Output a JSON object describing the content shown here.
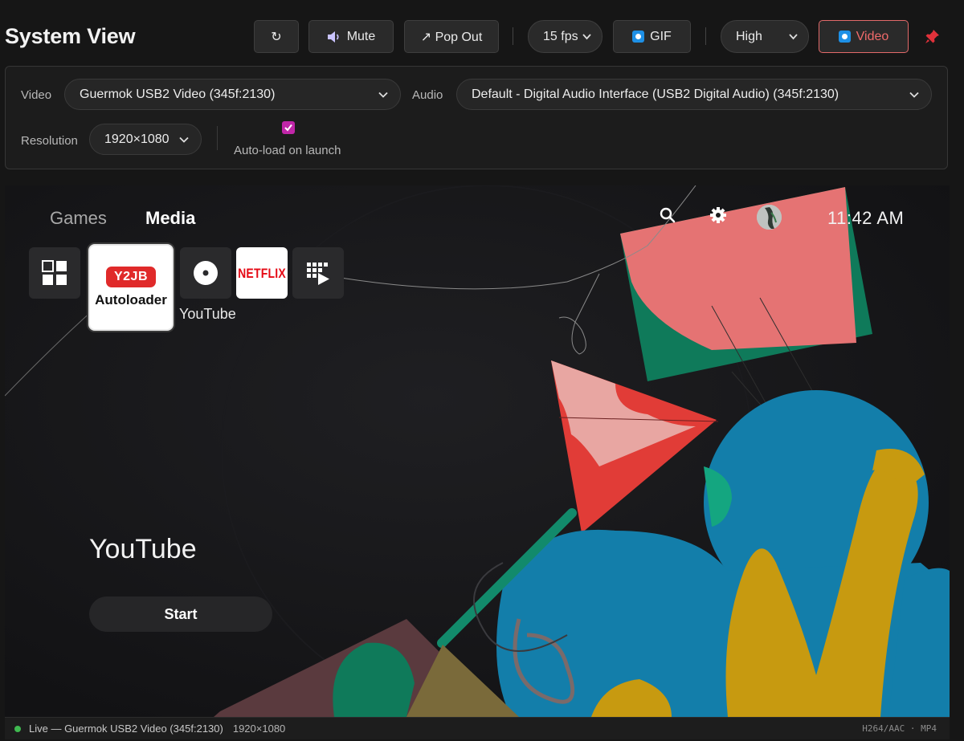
{
  "app": {
    "title": "System View"
  },
  "toolbar": {
    "refresh_label": "↻",
    "mute_label": "Mute",
    "popout_label": "↗ Pop Out",
    "fps_value": "15 fps",
    "gif_label": "GIF",
    "quality_value": "High",
    "video_label": "Video",
    "icons": {
      "mute": "speaker-icon",
      "gif": "record-icon",
      "video": "record-icon",
      "pin": "pin-icon"
    },
    "colors": {
      "record_icon": "#1e90e6",
      "video_active": "#f06a6a",
      "pin": "#e0313a"
    }
  },
  "devices": {
    "video_label": "Video",
    "video_value": "Guermok USB2 Video (345f:2130)",
    "audio_label": "Audio",
    "audio_value": "Default - Digital Audio Interface (USB2 Digital Audio) (345f:2130)",
    "resolution_label": "Resolution",
    "resolution_value": "1920×1080",
    "autoload_label": "Auto-load on launch",
    "autoload_checked": true,
    "checkbox_color": "#c026a8"
  },
  "stream": {
    "tabs": [
      "Games",
      "Media"
    ],
    "active_tab": "Media",
    "time": "11:42 AM",
    "header_icons": [
      "search-icon",
      "gear-icon",
      "avatar"
    ],
    "tiles": [
      {
        "name": "all-apps",
        "icon": "grid-icon"
      },
      {
        "name": "y2jb",
        "badge": "Y2JB",
        "sub": "Autoloader"
      },
      {
        "name": "youtube",
        "icon": "disc-icon"
      },
      {
        "name": "netflix",
        "text": "NETFLIX"
      },
      {
        "name": "media-gallery",
        "icon": "media-grid-icon"
      }
    ],
    "focused_label": "YouTube",
    "selected_title": "YouTube",
    "start_label": "Start"
  },
  "status": {
    "live_text": "Live — Guermok USB2 Video (345f:2130)",
    "resolution": "1920×1080",
    "codec": "H264/AAC · MP4",
    "live_color": "#3fb950"
  }
}
